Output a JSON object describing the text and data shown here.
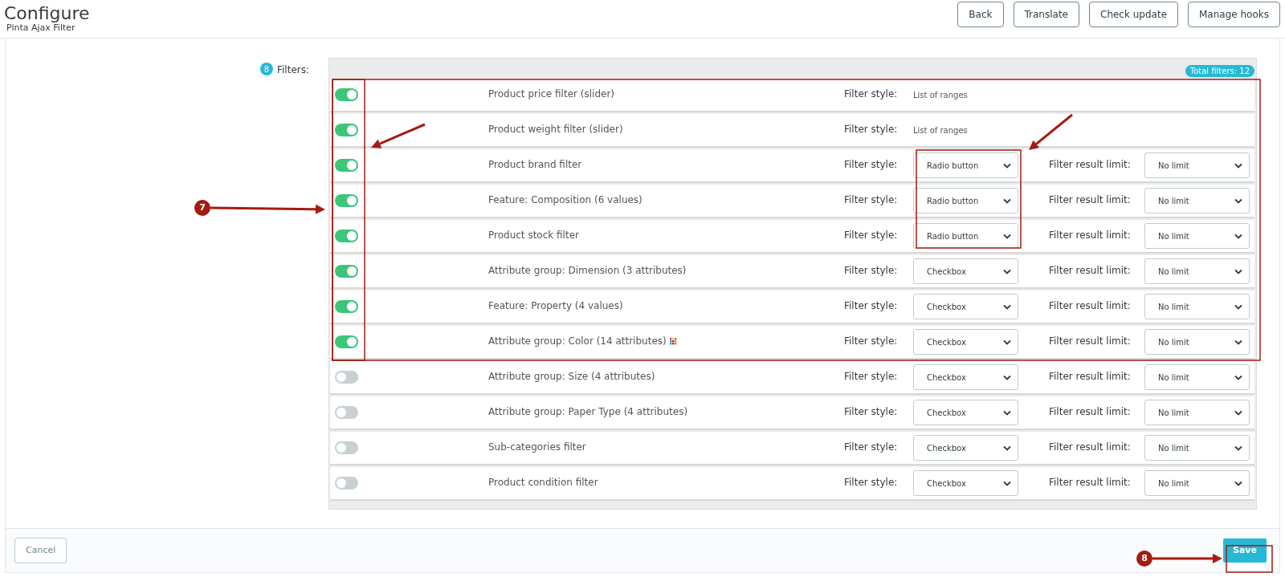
{
  "header": {
    "title": "Configure",
    "subtitle": "Pinta Ajax Filter",
    "buttons": [
      "Back",
      "Translate",
      "Check update",
      "Manage hooks"
    ]
  },
  "filters": {
    "step_badge": "8",
    "label": "Filters:",
    "total_badge": "Total filters: 12",
    "rows": [
      {
        "enabled": true,
        "name": "Product price filter (slider)",
        "swatch": false,
        "style_label": "Filter style:",
        "kind": "text",
        "style_value": "List of ranges"
      },
      {
        "enabled": true,
        "name": "Product weight filter (slider)",
        "swatch": false,
        "style_label": "Filter style:",
        "kind": "text",
        "style_value": "List of ranges"
      },
      {
        "enabled": true,
        "name": "Product brand filter",
        "swatch": false,
        "style_label": "Filter style:",
        "kind": "select",
        "style_value": "Radio button",
        "limit_label": "Filter result limit:",
        "limit_value": "No limit"
      },
      {
        "enabled": true,
        "name": "Feature: Composition (6 values)",
        "swatch": false,
        "style_label": "Filter style:",
        "kind": "select",
        "style_value": "Radio button",
        "limit_label": "Filter result limit:",
        "limit_value": "No limit"
      },
      {
        "enabled": true,
        "name": "Product stock filter",
        "swatch": false,
        "style_label": "Filter style:",
        "kind": "select",
        "style_value": "Radio button",
        "limit_label": "Filter result limit:",
        "limit_value": "No limit"
      },
      {
        "enabled": true,
        "name": "Attribute group: Dimension (3 attributes)",
        "swatch": false,
        "style_label": "Filter style:",
        "kind": "select",
        "style_value": "Checkbox",
        "limit_label": "Filter result limit:",
        "limit_value": "No limit"
      },
      {
        "enabled": true,
        "name": "Feature: Property (4 values)",
        "swatch": false,
        "style_label": "Filter style:",
        "kind": "select",
        "style_value": "Checkbox",
        "limit_label": "Filter result limit:",
        "limit_value": "No limit"
      },
      {
        "enabled": true,
        "name": "Attribute group: Color (14 attributes)",
        "swatch": true,
        "style_label": "Filter style:",
        "kind": "select",
        "style_value": "Checkbox",
        "limit_label": "Filter result limit:",
        "limit_value": "No limit"
      },
      {
        "enabled": false,
        "name": "Attribute group: Size (4 attributes)",
        "swatch": false,
        "style_label": "Filter style:",
        "kind": "select",
        "style_value": "Checkbox",
        "limit_label": "Filter result limit:",
        "limit_value": "No limit"
      },
      {
        "enabled": false,
        "name": "Attribute group: Paper Type (4 attributes)",
        "swatch": false,
        "style_label": "Filter style:",
        "kind": "select",
        "style_value": "Checkbox",
        "limit_label": "Filter result limit:",
        "limit_value": "No limit"
      },
      {
        "enabled": false,
        "name": "Sub-categories filter",
        "swatch": false,
        "style_label": "Filter style:",
        "kind": "select",
        "style_value": "Checkbox",
        "limit_label": "Filter result limit:",
        "limit_value": "No limit"
      },
      {
        "enabled": false,
        "name": "Product condition filter",
        "swatch": false,
        "style_label": "Filter style:",
        "kind": "select",
        "style_value": "Checkbox",
        "limit_label": "Filter result limit:",
        "limit_value": "No limit"
      }
    ]
  },
  "footer": {
    "cancel": "Cancel",
    "save": "Save"
  },
  "annotations": [
    {
      "kind": "callout",
      "label": "7"
    },
    {
      "kind": "callout",
      "label": "8"
    }
  ]
}
